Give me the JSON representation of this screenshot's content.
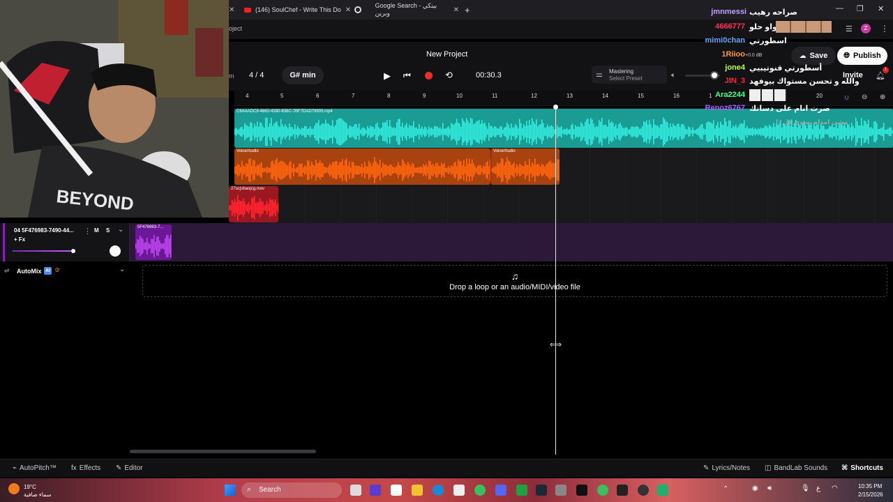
{
  "browser": {
    "tabs": [
      {
        "title": "(146) SoulChef - Write This Do"
      },
      {
        "title": "Google Search - بينكي وبرين"
      }
    ],
    "address_fragment": "oject"
  },
  "header": {
    "project_title": "New Project",
    "time_signature": "4 / 4",
    "key": "G# min",
    "time_display": "00:30.3",
    "mastering_label": "Mastering",
    "mastering_sub": "Select Preset",
    "save_label": "Save",
    "publish_label": "Publish",
    "invite_label": "Invite",
    "volume_db": "+0.0 dB",
    "notification_count": "1",
    "avatar_initial": "Z"
  },
  "ruler": {
    "ticks": [
      "4",
      "5",
      "6",
      "7",
      "8",
      "9",
      "10",
      "11",
      "12",
      "13",
      "14",
      "15",
      "16",
      "1",
      "20"
    ]
  },
  "tracks": {
    "clip1_label": "C6AAADC8-4862-4380-838C-7BF7DAD79905.mp4",
    "clip2_label": "Voice/Audio",
    "clip3_label": "Voice/Audio",
    "clip4_label": "27ucjvbaojcg.mov",
    "clip5_label": "5F476983-7..."
  },
  "track_header": {
    "name": "04  5F476983-7490-44...",
    "mute": "M",
    "solo": "S",
    "fx": "+ Fx",
    "automix": "AutoMix",
    "ai_badge": "AI"
  },
  "drop_zone": {
    "text": "Drop a loop or an audio/MIDI/video file"
  },
  "bottom_bar": {
    "autopitch": "AutoPitch™",
    "effects": "Effects",
    "editor": "Editor",
    "lyrics": "Lyrics/Notes",
    "sounds": "BandLab Sounds",
    "shortcuts": "Shortcuts"
  },
  "taskbar": {
    "weather_temp": "19°C",
    "weather_desc": "سماء صافية",
    "search_label": "Search",
    "time": "10:35 PM",
    "date": "2/15/2026",
    "lang": "ع"
  },
  "chat": [
    {
      "name": "jmnmessi",
      "msg": "صراحه رهيب",
      "color": "#c0a0ff"
    },
    {
      "name": "4666777",
      "msg": "واو حلو",
      "color": "#ff3060"
    },
    {
      "name": "mimi0chan",
      "msg": "اسطورتي",
      "color": "#5ab0ff"
    },
    {
      "name": "1Riioo",
      "msg": "",
      "color": "#ff9a20"
    },
    {
      "name": "jone4",
      "msg": "أسطورتي قنوتيبيي",
      "color": "#b8ff40"
    },
    {
      "name": "JIN_3",
      "msg": "والله و تحسن مستواك بيوفهد",
      "color": "#ff2040"
    },
    {
      "name": "Ara2244",
      "msg": "",
      "color": "#40ff90"
    },
    {
      "name": "Renoz6767",
      "msg": "صرت انام على دساتك",
      "color": "#b060ff"
    }
  ],
  "chat_extra": "مشى امداه يسوي كل ذا",
  "colors": {
    "teal": "#1fbfb3",
    "orange": "#f06a1f",
    "red": "#d4202c",
    "purple": "#8a1fb8"
  }
}
